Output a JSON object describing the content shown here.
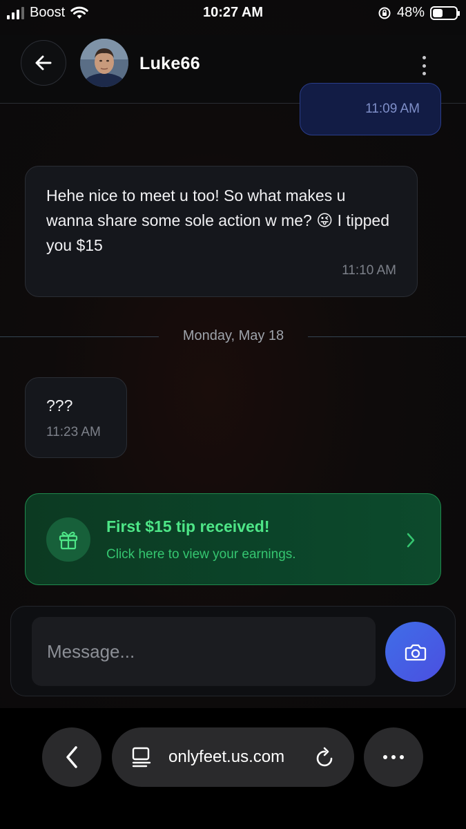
{
  "status_bar": {
    "carrier": "Boost",
    "time": "10:27 AM",
    "battery_percent": "48%",
    "battery_level": 0.48,
    "icons": [
      "signal-icon",
      "wifi-icon",
      "orientation-lock-icon",
      "battery-icon"
    ]
  },
  "header": {
    "username": "Luke66",
    "back_icon": "arrow-left-icon",
    "menu_icon": "more-vertical-icon"
  },
  "messages": [
    {
      "direction": "outgoing",
      "time": "11:09 AM",
      "text": ""
    },
    {
      "direction": "incoming",
      "text": "Hehe nice to meet u too! So what makes u wanna share some sole action w me? 😜 I tipped you $15",
      "time": "11:10 AM"
    },
    {
      "direction": "incoming",
      "text": "???",
      "time": "11:23 AM"
    }
  ],
  "date_divider": "Monday, May 18",
  "tip_banner": {
    "title": "First $15 tip received!",
    "subtitle": "Click here to view your earnings.",
    "icon": "gift-icon"
  },
  "composer": {
    "placeholder": "Message...",
    "camera_icon": "camera-icon"
  },
  "browser": {
    "url": "onlyfeet.us.com",
    "icons": [
      "chevron-left-icon",
      "reader-icon",
      "reload-icon",
      "more-horizontal-icon"
    ]
  },
  "colors": {
    "background": "#0a0a0b",
    "outgoing_bubble": "#121c45",
    "incoming_bubble": "#15171c",
    "tip_accent": "#4ee687",
    "camera_button": "#4159e4"
  }
}
